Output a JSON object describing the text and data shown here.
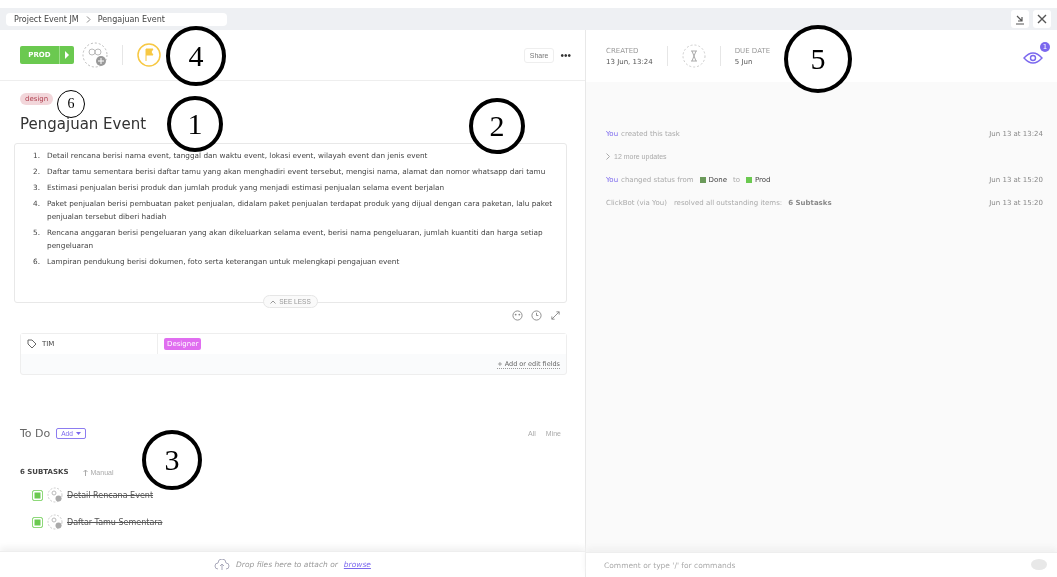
{
  "breadcrumb": [
    "Project Event JM",
    "Pengajuan Event"
  ],
  "toolbar": {
    "status": "PROD",
    "share": "Share",
    "more": "•••"
  },
  "tag": "design",
  "title": "Pengajuan Event",
  "description": [
    {
      "marker": "1.",
      "text": "Detail rencana berisi nama event, tanggal dan waktu event, lokasi event, wilayah event dan jenis event"
    },
    {
      "marker": "2.",
      "text": "Daftar tamu sementara berisi daftar tamu yang akan menghadiri event tersebut, mengisi nama, alamat dan nomor whatsapp dari tamu"
    },
    {
      "marker": "3.",
      "text": "Estimasi penjualan berisi produk dan jumlah produk yang menjadi estimasi penjualan selama event berjalan"
    },
    {
      "marker": "4.",
      "text": "Paket penjualan berisi pembuatan paket penjualan, didalam paket penjualan terdapat produk yang dijual dengan cara paketan, lalu paket penjualan tersebut diberi hadiah"
    },
    {
      "marker": "5.",
      "text": "Rencana anggaran berisi pengeluaran yang akan dikeluarkan selama event, berisi nama pengeluaran, jumlah kuantiti dan harga setiap pengeluaran"
    },
    {
      "marker": "6.",
      "text": "Lampiran pendukung berisi dokumen, foto serta keterangan untuk melengkapi pengajuan event"
    }
  ],
  "see_less": "SEE LESS",
  "fields": [
    {
      "name": "TIM",
      "value": "Designer",
      "color": "#e06ef0"
    }
  ],
  "add_fields": "+ Add or edit fields",
  "todo": {
    "title": "To Do",
    "add": "Add",
    "filters": [
      {
        "label": "All",
        "selected": false
      },
      {
        "label": "Mine",
        "selected": false
      }
    ]
  },
  "subtasks": {
    "count": "6 SUBTASKS",
    "sort": "Manual",
    "items": [
      {
        "name": "Detail Rencana Event",
        "done": true
      },
      {
        "name": "Daftar Tamu Sementara",
        "done": true
      }
    ]
  },
  "drop": {
    "text": "Drop files here to attach or",
    "link": "browse"
  },
  "dates": {
    "created_label": "CREATED",
    "created": "13 Jun, 13:24",
    "due_label": "DUE DATE",
    "due": "5 Jun"
  },
  "watchers": "1",
  "activity": [
    {
      "kind": "action",
      "actor": "You",
      "text": "created this task",
      "time": "Jun 13 at 13:24"
    },
    {
      "kind": "more",
      "text": "12 more updates"
    },
    {
      "kind": "status",
      "actor": "You",
      "text": "changed status from",
      "from": {
        "label": "Done",
        "color": "#6b9a5a"
      },
      "joiner": "to",
      "to": {
        "label": "Prod",
        "color": "#6bc950"
      },
      "time": "Jun 13 at 15:20"
    },
    {
      "kind": "bot",
      "actor": "ClickBot (via You)",
      "text": "resolved all outstanding items:",
      "detail": "6 Subtasks",
      "time": "Jun 13 at 15:20"
    }
  ],
  "comment": {
    "placeholder": "Comment or type '/' for commands"
  },
  "annotations": [
    {
      "label": "4"
    },
    {
      "label": "1"
    },
    {
      "label": "2"
    },
    {
      "label": "3"
    },
    {
      "label": "5"
    },
    {
      "label": "6"
    }
  ]
}
